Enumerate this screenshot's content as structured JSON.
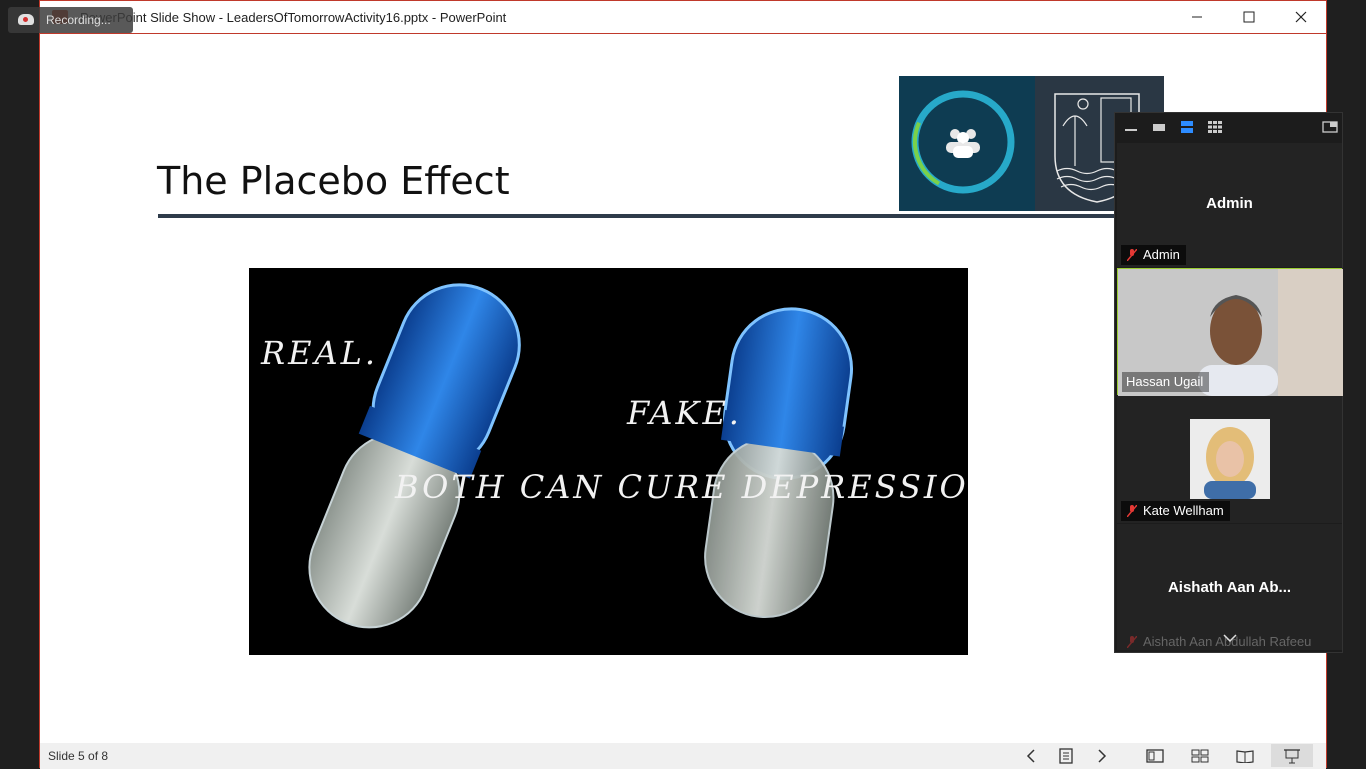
{
  "window": {
    "title": "PowerPoint Slide Show  -  LeadersOfTomorrowActivity16.pptx - PowerPoint",
    "minimize_icon": "minimize-icon",
    "maximize_icon": "maximize-icon",
    "close_icon": "close-icon"
  },
  "recording": {
    "label": "Recording..."
  },
  "slide": {
    "title": "The Placebo Effect",
    "image_text": {
      "real": "REAL.",
      "fake": "FAKE.",
      "tagline": "BOTH CAN CURE DEPRESSION."
    }
  },
  "statusbar": {
    "slide_counter": "Slide 5 of 8",
    "icons": [
      "previous-icon",
      "slide-list-icon",
      "next-icon",
      "normal-view-icon",
      "slide-sorter-icon",
      "reading-view-icon",
      "slideshow-icon"
    ]
  },
  "zoom_panel": {
    "participants": [
      {
        "name": "Admin",
        "label": "Admin",
        "muted": true
      },
      {
        "name": "Hassan Ugail",
        "label": "Hassan Ugail",
        "muted": false
      },
      {
        "name": "Kate Wellham",
        "label": "Kate Wellham",
        "muted": true
      },
      {
        "name": "Aishath Aan Ab...",
        "label": "Aishath Aan Abdullah Rafeeu",
        "muted": true
      }
    ]
  },
  "colors": {
    "accent": "#c0392b",
    "title_rule": "#2e3b4a",
    "pill_blue": "#1f6fd1",
    "active_speaker": "#9acd32"
  }
}
